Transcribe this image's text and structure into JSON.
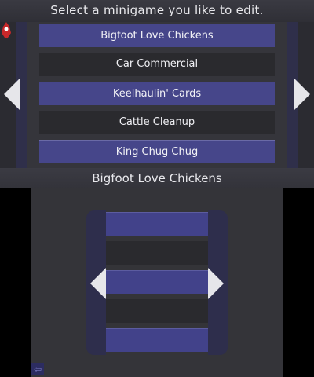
{
  "top_screen": {
    "title": "Select a minigame you like to edit.",
    "items": [
      {
        "label": "Bigfoot Love Chickens"
      },
      {
        "label": "Car Commercial"
      },
      {
        "label": "Keelhaulin' Cards"
      },
      {
        "label": "Cattle Cleanup"
      },
      {
        "label": "King Chug Chug"
      }
    ],
    "icons": {
      "left": "left-arrow-icon",
      "right": "right-arrow-icon",
      "mascot": "mascot-icon"
    }
  },
  "selected": {
    "title": "Bigfoot Love Chickens"
  },
  "bottom_screen": {
    "icons": {
      "left": "left-arrow-icon",
      "right": "right-arrow-icon",
      "back": "back-icon"
    },
    "back_glyph": "⇦"
  },
  "colors": {
    "item_highlight": "#46468a",
    "item_dark": "#2a2a2e",
    "background": "#343439",
    "text": "#f2f2f6",
    "arrow": "#e6e6ea"
  }
}
